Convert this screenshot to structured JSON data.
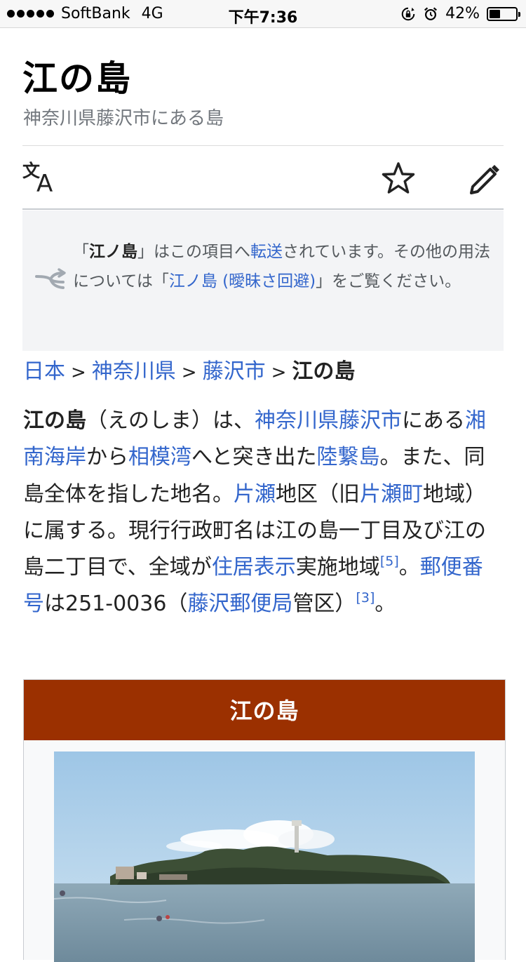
{
  "status_bar": {
    "carrier": "SoftBank",
    "network": "4G",
    "time": "下午7:36",
    "battery_percent": "42%",
    "battery_level": 0.42
  },
  "article": {
    "title": "江の島",
    "description": "神奈川県藤沢市にある島"
  },
  "toolbar": {
    "language_icon": "translate-icon",
    "watch_icon": "star-icon",
    "edit_icon": "pencil-icon"
  },
  "hatnote": {
    "part1": "「",
    "term": "江ノ島",
    "part2": "」はこの項目へ",
    "link1": "転送",
    "part3": "されています。その他の用法については「",
    "link2": "江ノ島 (曖昧さ回避)",
    "part4": "」をご覧ください。"
  },
  "breadcrumb": {
    "items": [
      "日本",
      "神奈川県",
      "藤沢市"
    ],
    "separator": ">",
    "current": "江の島"
  },
  "lead": {
    "term": "江の島",
    "t1": "（えのしま）は、",
    "l1": "神奈川県藤沢市",
    "t2": "にある",
    "l2": "湘南海岸",
    "t3": "から",
    "l3": "相模湾",
    "t4": "へと突き出た",
    "l4": "陸繋島",
    "t5": "。また、同島全体を指した地名。",
    "l5": "片瀬",
    "t6": "地区（旧",
    "l6": "片瀬町",
    "t7": "地域）に属する。現行行政町名は江の島一丁目及び江の島二丁目で、全域が",
    "l7": "住居表示",
    "t8": "実施地域",
    "ref1": "[5]",
    "t9": "。",
    "l8": "郵便番号",
    "t10": "は251-0036（",
    "l9": "藤沢郵便局",
    "t11": "管区）",
    "ref2": "[3]",
    "t12": "。"
  },
  "infobox": {
    "header": "江の島"
  },
  "colors": {
    "link": "#3366cc",
    "infobox_header": "#9b3000",
    "hatnote_bg": "#f3f4f6"
  }
}
